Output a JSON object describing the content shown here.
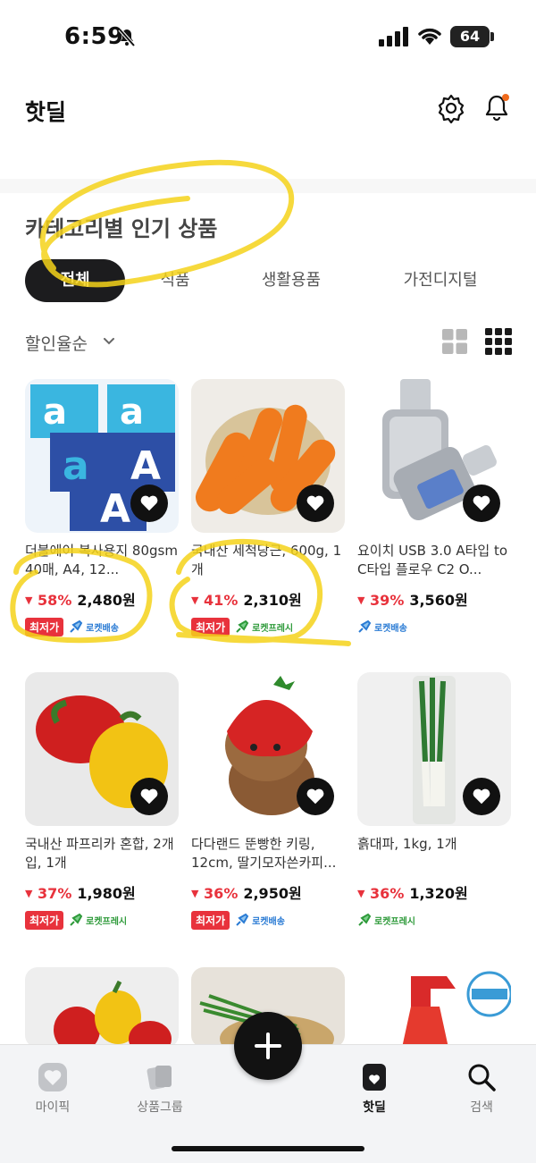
{
  "status_bar": {
    "time": "6:59",
    "battery": "64"
  },
  "header": {
    "title": "핫딜"
  },
  "section": {
    "title": "카테고리별 인기 상품"
  },
  "tabs": [
    {
      "label": "전체",
      "active": true
    },
    {
      "label": "식품",
      "active": false
    },
    {
      "label": "생활용품",
      "active": false
    },
    {
      "label": "가전디지털",
      "active": false
    }
  ],
  "sort": {
    "label": "할인율순"
  },
  "products": [
    {
      "name": "더블에이 복사용지 80gsm 40매, A4, 12...",
      "discount": "58%",
      "price": "2,480원",
      "lowest_badge": "최저가",
      "shipping": "로켓배송",
      "shipping_type": "rocket"
    },
    {
      "name": "국내산 세척당근, 600g, 1개",
      "discount": "41%",
      "price": "2,310원",
      "lowest_badge": "최저가",
      "shipping": "로켓프레시",
      "shipping_type": "fresh"
    },
    {
      "name": "요이치 USB 3.0 A타입 to C타입 플로우 C2 O...",
      "discount": "39%",
      "price": "3,560원",
      "lowest_badge": "",
      "shipping": "로켓배송",
      "shipping_type": "rocket"
    },
    {
      "name": "국내산 파프리카 혼합, 2개입, 1개",
      "discount": "37%",
      "price": "1,980원",
      "lowest_badge": "최저가",
      "shipping": "로켓프레시",
      "shipping_type": "fresh"
    },
    {
      "name": "다다랜드 뚠빵한 키링, 12cm, 딸기모자쓴카피...",
      "discount": "36%",
      "price": "2,950원",
      "lowest_badge": "최저가",
      "shipping": "로켓배송",
      "shipping_type": "rocket"
    },
    {
      "name": "흙대파, 1kg, 1개",
      "discount": "36%",
      "price": "1,320원",
      "lowest_badge": "",
      "shipping": "로켓프레시",
      "shipping_type": "fresh"
    }
  ],
  "nav": [
    {
      "label": "마이픽",
      "icon": "heart-icon"
    },
    {
      "label": "상품그룹",
      "icon": "cards-icon"
    },
    {
      "label": "핫딜",
      "icon": "hotdeal-icon"
    },
    {
      "label": "검색",
      "icon": "search-icon"
    }
  ],
  "colors": {
    "accent_red": "#e8323c",
    "rocket_blue": "#2a7bd4",
    "fresh_green": "#2e9a3a",
    "highlighter": "#f5d21a"
  }
}
